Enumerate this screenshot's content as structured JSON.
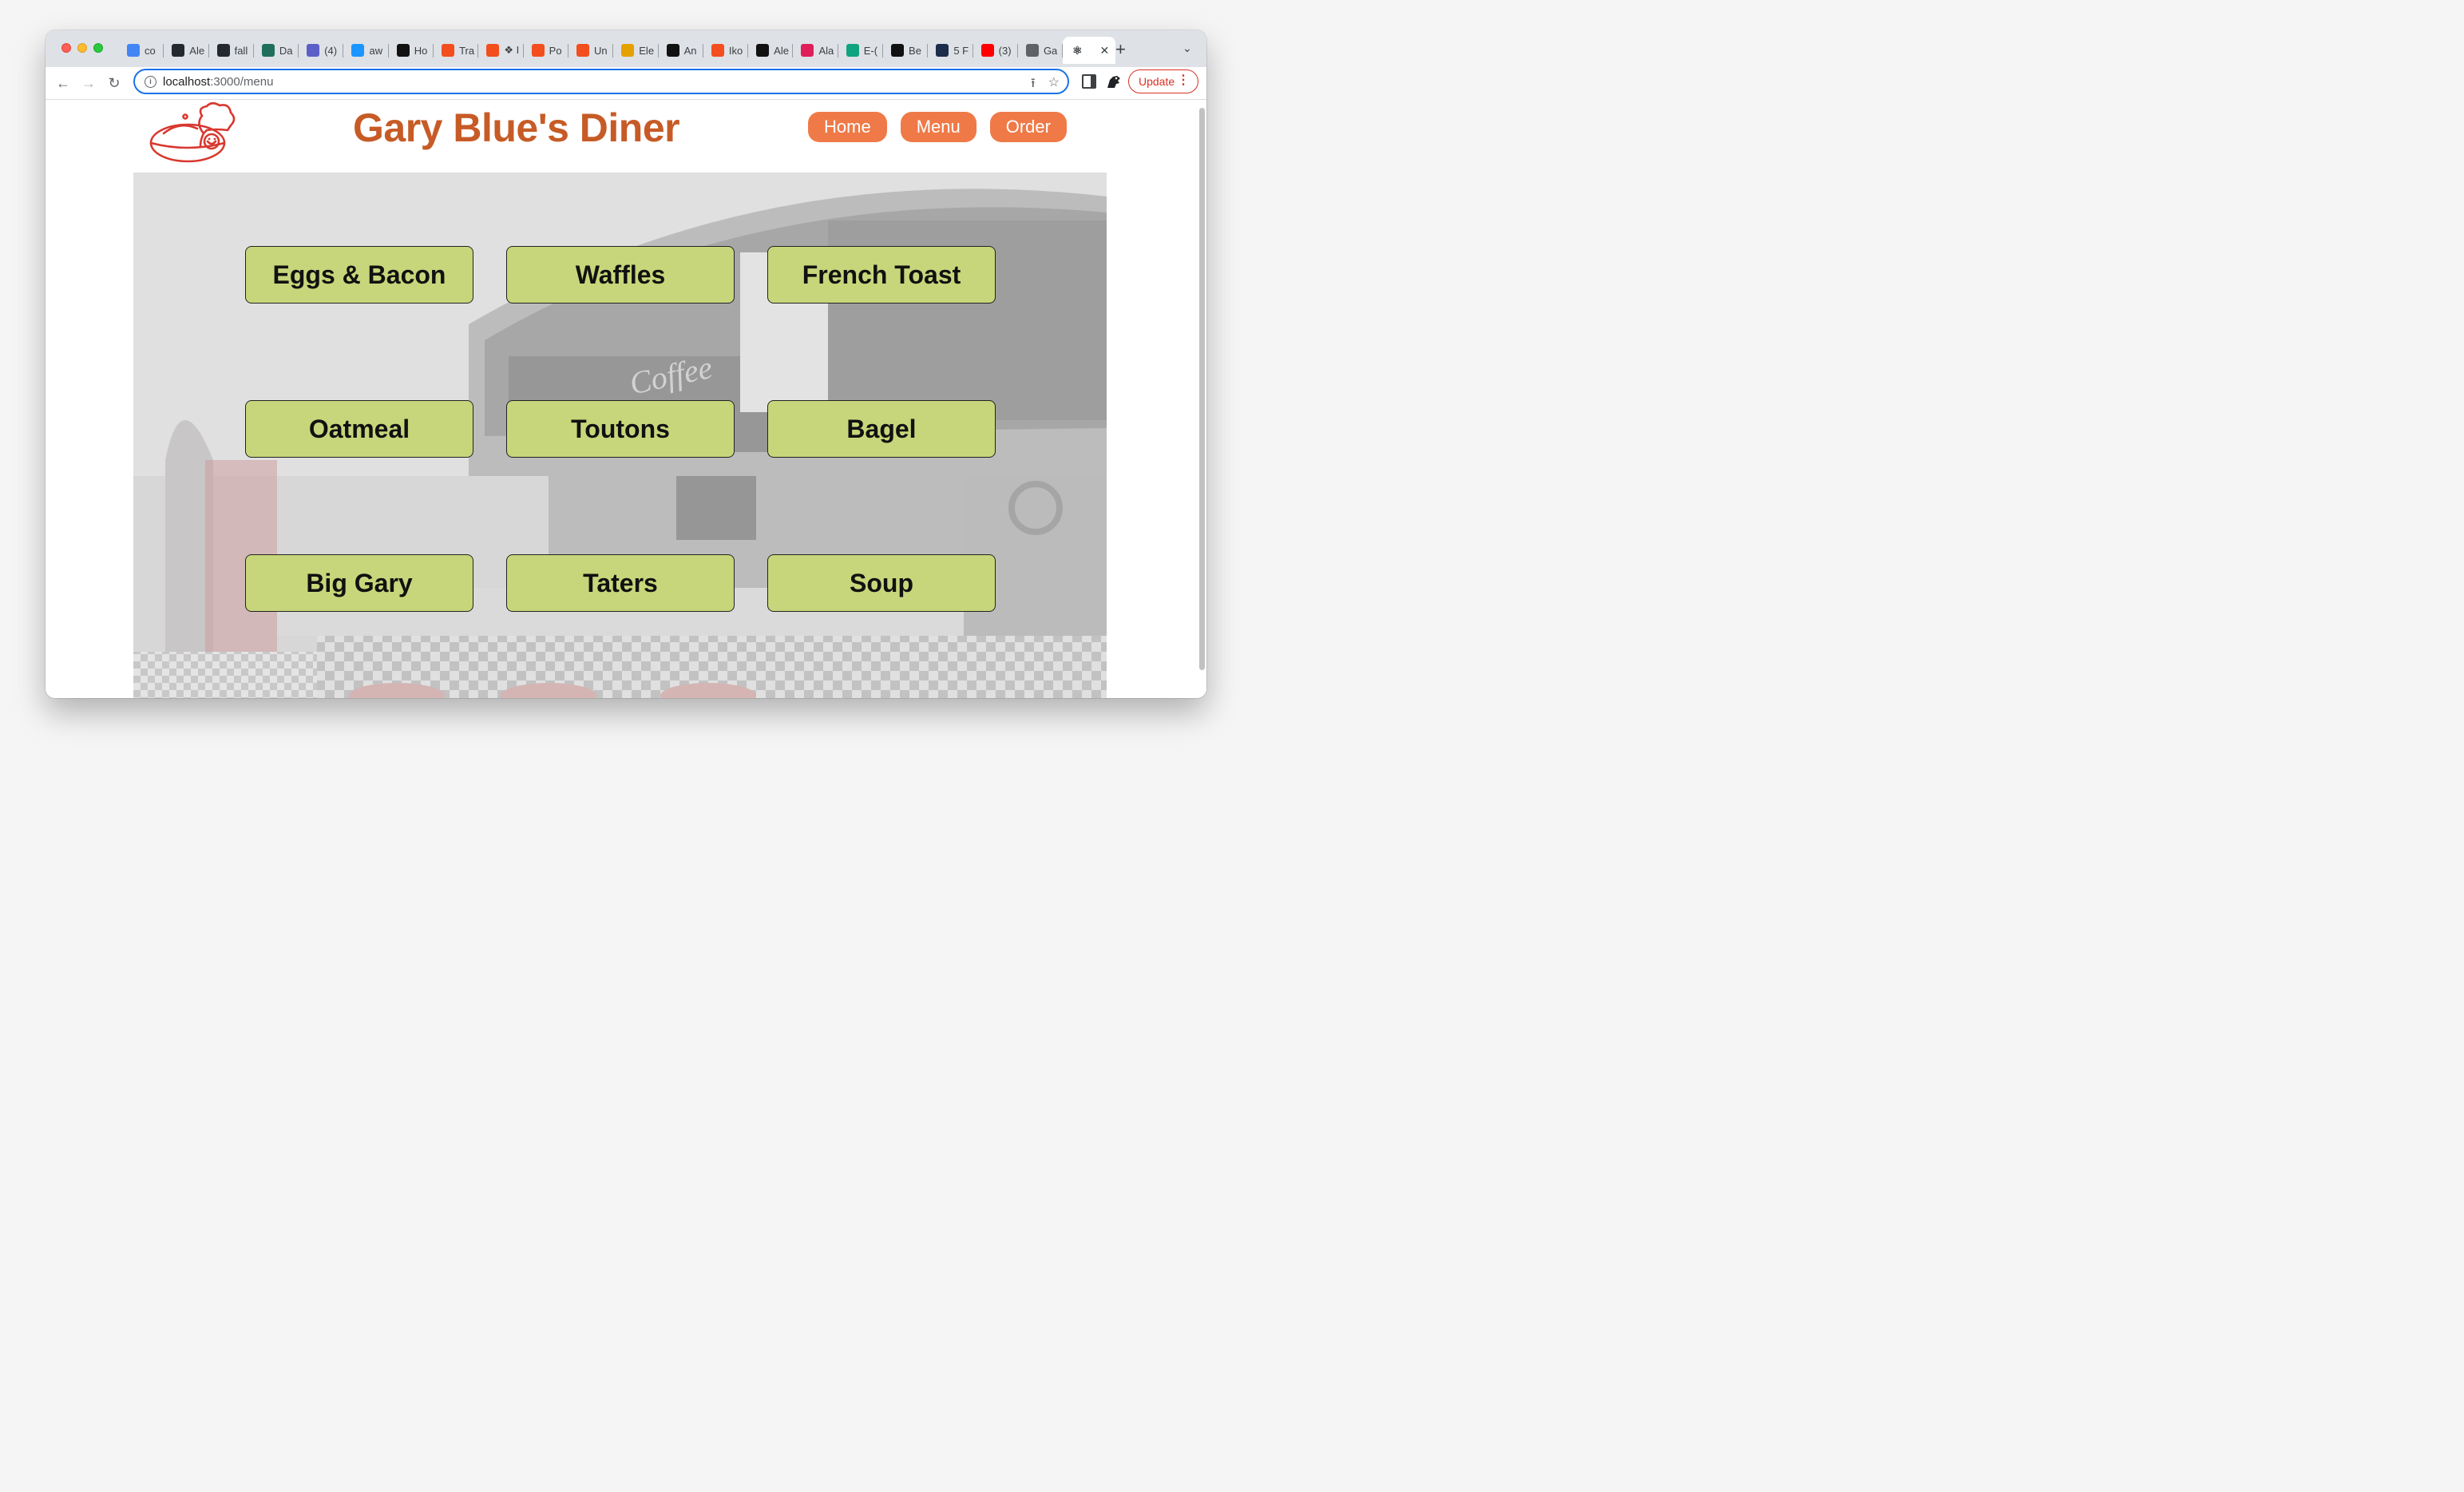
{
  "browser": {
    "tabs": [
      {
        "label": "co",
        "icon": "google-icon",
        "color": "#4285f4"
      },
      {
        "label": "Ale",
        "icon": "github-icon",
        "color": "#24292f"
      },
      {
        "label": "fall",
        "icon": "github-icon",
        "color": "#24292f"
      },
      {
        "label": "Da",
        "icon": "c-app-icon",
        "color": "#1f6f5c"
      },
      {
        "label": "(4)",
        "icon": "teams-icon",
        "color": "#5b5fc7"
      },
      {
        "label": "aw",
        "icon": "cloud-icon",
        "color": "#1b96ff"
      },
      {
        "label": "Ho",
        "icon": "circle-logo-icon",
        "color": "#111111"
      },
      {
        "label": "Tra",
        "icon": "figma-icon",
        "color": "#f24e1e"
      },
      {
        "label": "❖ I",
        "icon": "figma-icon",
        "color": "#f24e1e"
      },
      {
        "label": "Po",
        "icon": "figma-icon",
        "color": "#f24e1e"
      },
      {
        "label": "Un",
        "icon": "figma-icon",
        "color": "#f24e1e"
      },
      {
        "label": "Ele",
        "icon": "bag-icon",
        "color": "#e5a100"
      },
      {
        "label": "An",
        "icon": "amazon-icon",
        "color": "#111111"
      },
      {
        "label": "Iko",
        "icon": "figma-icon",
        "color": "#f24e1e"
      },
      {
        "label": "Ale",
        "icon": "framer-icon",
        "color": "#111111"
      },
      {
        "label": "Ala",
        "icon": "slack-icon",
        "color": "#e01e5a"
      },
      {
        "label": "E-(",
        "icon": "openai-icon",
        "color": "#10a37f"
      },
      {
        "label": "Be",
        "icon": "w-logo-icon",
        "color": "#111111"
      },
      {
        "label": "5 F",
        "icon": "a-logo-icon",
        "color": "#1c2c4c"
      },
      {
        "label": "(3)",
        "icon": "youtube-icon",
        "color": "#ff0000"
      },
      {
        "label": "Ga",
        "icon": "globe-icon",
        "color": "#5f6368"
      }
    ],
    "active_tab_icon": "react-icon",
    "url_host": "localhost",
    "url_rest": ":3000/menu",
    "update_label": "Update"
  },
  "site": {
    "title": "Gary Blue's Diner",
    "nav": [
      "Home",
      "Menu",
      "Order"
    ],
    "logo_icon": "chef-logo-icon"
  },
  "menu": {
    "items": [
      "Eggs & Bacon",
      "Waffles",
      "French Toast",
      "Oatmeal",
      "Toutons",
      "Bagel",
      "Big Gary",
      "Taters",
      "Soup"
    ]
  },
  "colors": {
    "title": "#c75b26",
    "nav_button": "#ef7a48",
    "menu_button": "#c7d67a"
  }
}
